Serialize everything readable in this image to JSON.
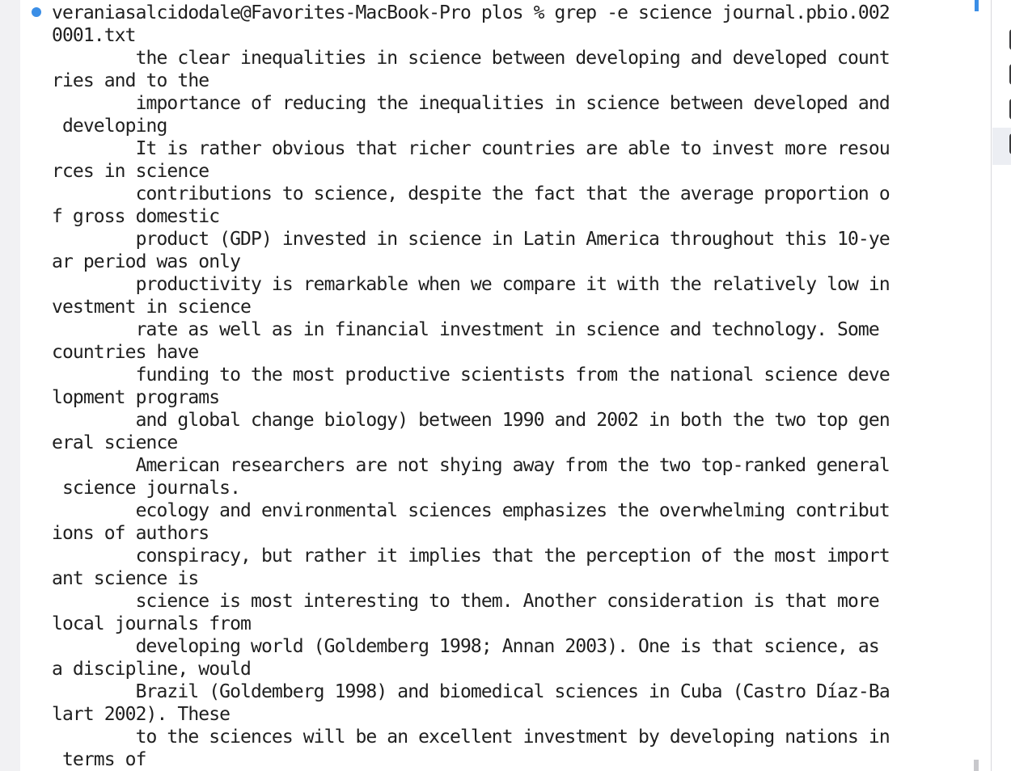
{
  "terminal": {
    "command_line": "veraniasalcidodale@Favorites-MacBook-Pro plos % grep -e science journal.pbio.002\n0001.txt",
    "output_lines": [
      "        the clear inequalities in science between developing and developed count\nries and to the",
      "        importance of reducing the inequalities in science between developed and\n developing",
      "        It is rather obvious that richer countries are able to invest more resou\nrces in science",
      "        contributions to science, despite the fact that the average proportion o\nf gross domestic",
      "        product (GDP) invested in science in Latin America throughout this 10-ye\nar period was only",
      "        productivity is remarkable when we compare it with the relatively low in\nvestment in science",
      "        rate as well as in financial investment in science and technology. Some \ncountries have",
      "        funding to the most productive scientists from the national science deve\nlopment programs",
      "        and global change biology) between 1990 and 2002 in both the two top gen\neral science",
      "        American researchers are not shying away from the two top-ranked general\n science journals.",
      "        ecology and environmental sciences emphasizes the overwhelming contribut\nions of authors",
      "        conspiracy, but rather it implies that the perception of the most import\nant science is",
      "        science is most interesting to them. Another consideration is that more \nlocal journals from",
      "        developing world (Goldemberg 1998; Annan 2003). One is that science, as \na discipline, would",
      "        Brazil (Goldemberg 1998) and biomedical sciences in Cuba (Castro Díaz-Ba\nlart 2002). These",
      "        to the sciences will be an excellent investment by developing nations in\n terms of"
    ]
  },
  "colors": {
    "prompt_dot": "#3b8ee6",
    "text": "#1f1f1f",
    "background": "#ffffff",
    "gutter": "#f1f1f3"
  },
  "icons": {
    "prompt_marker": "prompt-dot-icon"
  }
}
